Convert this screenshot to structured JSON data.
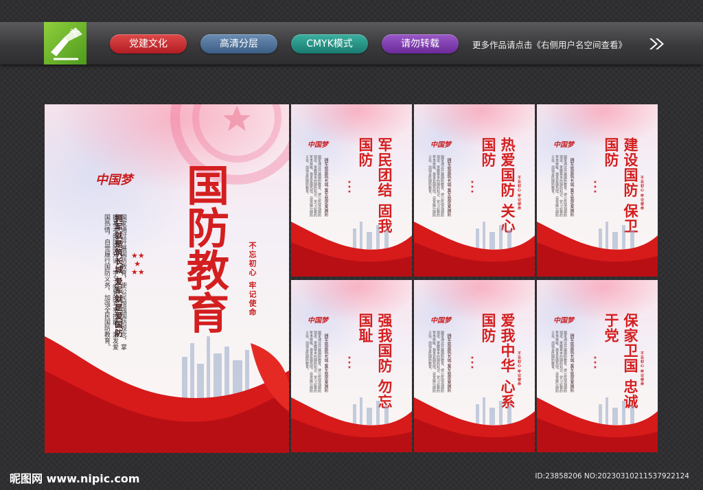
{
  "header": {
    "tags": [
      "党建文化",
      "高清分层",
      "CMYK模式",
      "请勿转载"
    ],
    "more_text": "更多作品请点击《右侧用户名空间查看》"
  },
  "main_poster": {
    "title": "国防教育",
    "slogan": "拥军就是筑长城 爱军就是爱国防",
    "body": "国家通过开展国防教育，使公民增强国防观念，掌握基本的国防知识，学习必要的军事技能，激发爱国热情，自觉履行国防义务，加强全民国防教育。",
    "seal": "不忘初心 牢记使命",
    "dream": "中国梦"
  },
  "small_posters": [
    {
      "title": "军民团结 固我国防"
    },
    {
      "title": "热爱国防 关心国防"
    },
    {
      "title": "建设国防 保卫国防"
    },
    {
      "title": "强我国防 勿忘国耻"
    },
    {
      "title": "爱我中华 心系国防"
    },
    {
      "title": "保家卫国 忠诚于党"
    }
  ],
  "small_slogan": "拥军就是筑长城 爱军就是爱国防",
  "small_seal": "不忘初心 牢记使命",
  "footer": {
    "site": "昵图网 www.nipic.com",
    "id": "ID:23858206 NO:20230310211537922124"
  },
  "colors": {
    "accent_red": "#d31f1f",
    "logo_green": "#6ab42c"
  }
}
